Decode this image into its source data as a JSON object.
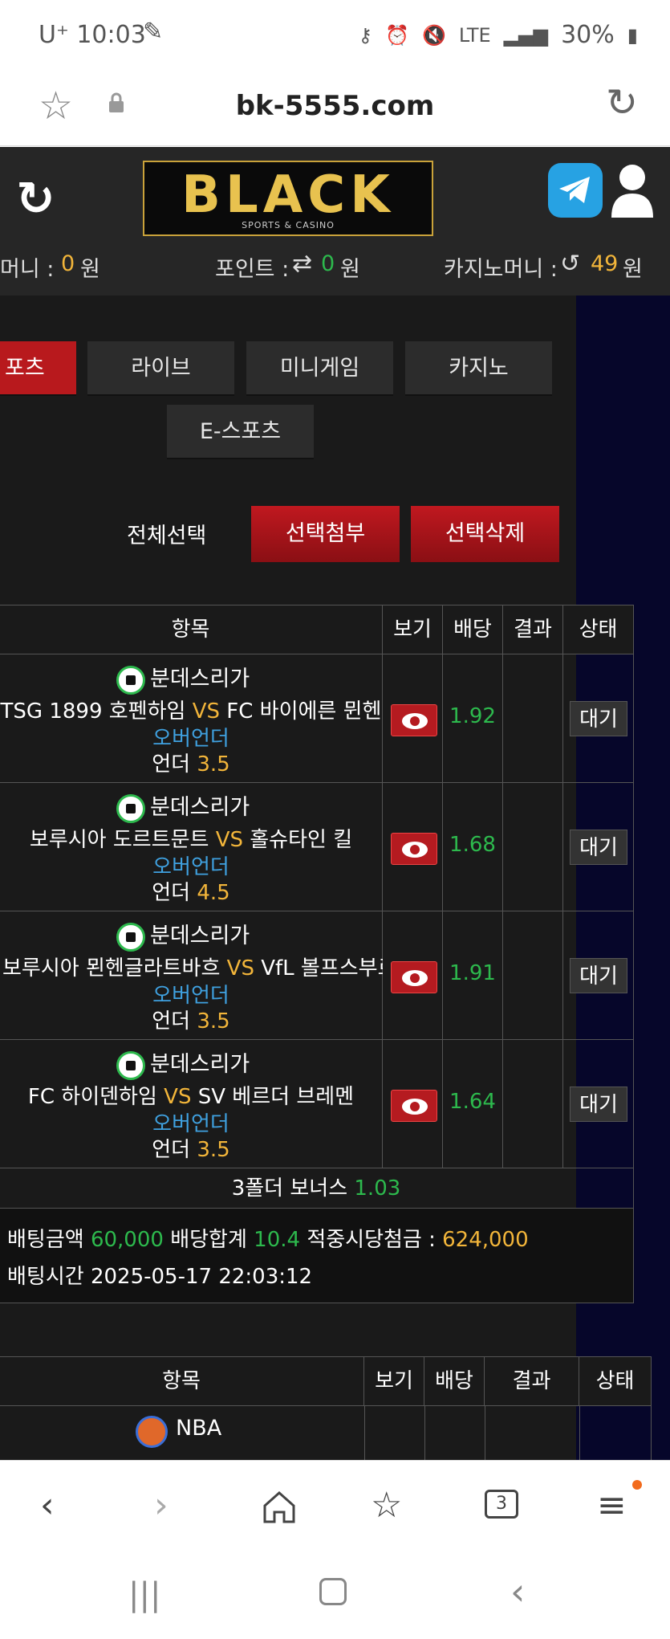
{
  "status": {
    "carrier": "U⁺ 10:03",
    "battery": "30%"
  },
  "urlbar": {
    "url": "bk-5555.com"
  },
  "header": {
    "logo_text": "BLACK",
    "logo_sub": "SPORTS & CASINO",
    "money_label": "머니 :",
    "money_value": "0",
    "money_unit": "원",
    "point_label": "포인트 :",
    "point_value": "0",
    "point_unit": "원",
    "casino_label": "카지노머니 :",
    "casino_value": "49",
    "casino_unit": "원"
  },
  "tabs": [
    "포츠",
    "라이브",
    "미니게임",
    "카지노",
    "E-스포츠"
  ],
  "actions": {
    "select_all": "전체선택",
    "attach": "선택첨부",
    "delete": "선택삭제"
  },
  "table1": {
    "headers": [
      "항목",
      "보기",
      "배당",
      "결과",
      "상태"
    ],
    "rows": [
      {
        "league": "분데스리가",
        "home": "TSG 1899 호펜하임",
        "vs": "VS",
        "away": "FC 바이에른 뮌헨",
        "market": "오버언더",
        "pick": "언더",
        "line": "3.5",
        "odds": "1.92",
        "status": "대기"
      },
      {
        "league": "분데스리가",
        "home": "보루시아 도르트문트",
        "vs": "VS",
        "away": "홀슈타인 킬",
        "market": "오버언더",
        "pick": "언더",
        "line": "4.5",
        "odds": "1.68",
        "status": "대기"
      },
      {
        "league": "분데스리가",
        "home": "보루시아 묀헨글라트바흐",
        "vs": "VS",
        "away": "VfL 볼프스부르크",
        "market": "오버언더",
        "pick": "언더",
        "line": "3.5",
        "odds": "1.91",
        "status": "대기"
      },
      {
        "league": "분데스리가",
        "home": "FC 하이덴하임",
        "vs": "VS",
        "away": "SV 베르더 브레멘",
        "market": "오버언더",
        "pick": "언더",
        "line": "3.5",
        "odds": "1.64",
        "status": "대기"
      }
    ],
    "bonus_label": "3폴더 보너스",
    "bonus_value": "1.03",
    "bet_amount_label": "배팅금액",
    "bet_amount": "60,000",
    "bet_total_label": "배당합계",
    "bet_total": "10.4",
    "payout_label": "적중시당첨금 :",
    "payout": "624,000",
    "bet_time_label": "배팅시간",
    "bet_time": "2025-05-17 22:03:12"
  },
  "table2": {
    "headers": [
      "항목",
      "보기",
      "배당",
      "결과",
      "상태"
    ],
    "league": "NBA"
  },
  "bottom_nav": {
    "tabs_count": "3"
  }
}
